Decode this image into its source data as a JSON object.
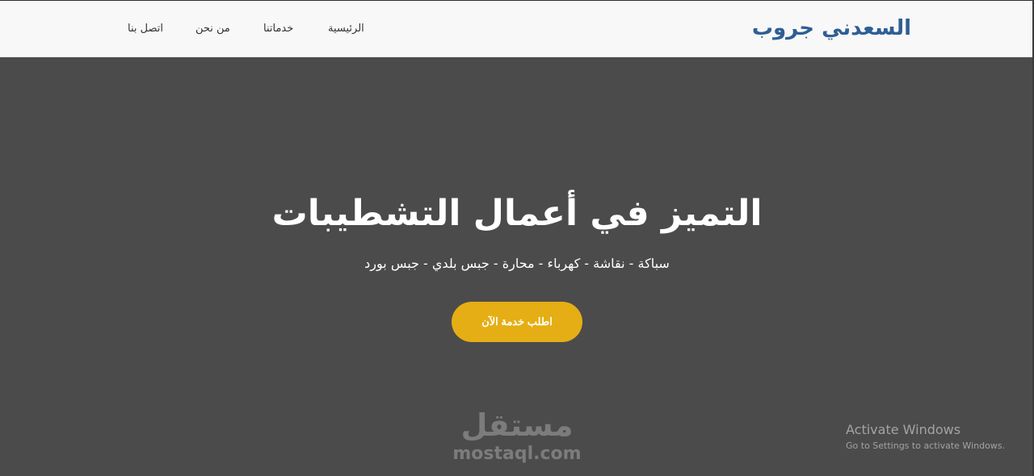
{
  "header": {
    "brand": "السعدني جروب",
    "nav": [
      {
        "label": "اتصل بنا"
      },
      {
        "label": "من نحن"
      },
      {
        "label": "خدماتنا"
      },
      {
        "label": "الرئيسية"
      }
    ]
  },
  "hero": {
    "title": "التميز في أعمال التشطيبات",
    "subtitle": "سباكة - نقاشة - كهرباء - محارة - جبس بلدي - جبس بورد",
    "cta_label": "اطلب خدمة الآن"
  },
  "watermark": {
    "arabic": "مستقل",
    "latin": "mostaql.com"
  },
  "os_notice": {
    "title": "Activate Windows",
    "subtitle": "Go to Settings to activate Windows."
  },
  "colors": {
    "brand": "#2e5f94",
    "navbar_bg": "#f8f8f8",
    "hero_bg": "#4b4b4b",
    "cta_bg": "#e5ae14",
    "hero_text": "#ffffff"
  }
}
